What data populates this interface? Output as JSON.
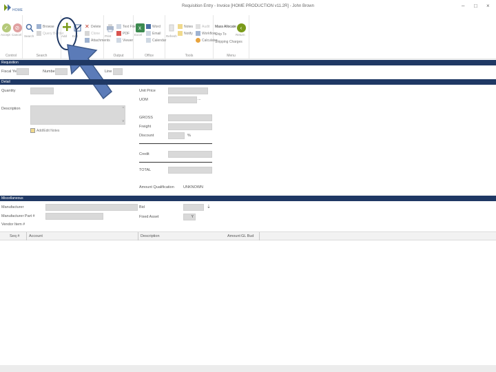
{
  "window": {
    "logo_text": "HOME",
    "title": "Requisition Entry - Invoice [HOME PRODUCTION v11.2R] - John Brown",
    "min_btn": "–",
    "max_btn": "□",
    "close_btn": "×"
  },
  "ribbon": {
    "groups": {
      "control": "Control",
      "search": "Search",
      "output": "Output",
      "office": "Office",
      "tools": "Tools",
      "menu": "Menu"
    },
    "buttons": {
      "accept": "Accept",
      "cancel": "Cancel",
      "search": "Search",
      "browse": "Browse",
      "query_builder": "Query Builder",
      "add": "Add",
      "edit": "Edit",
      "delete": "Delete",
      "clone": "Clone",
      "attachments": "Attachments",
      "print": "Print",
      "text_file": "Text File",
      "pdf": "PDF",
      "viewer": "Viewer",
      "excel": "Excel",
      "word": "Word",
      "email": "Email",
      "calendar": "Calendar",
      "refresh": "Refresh",
      "notes": "Notes",
      "notify": "Notify",
      "audit": "Audit",
      "workflow": "Workflow",
      "calculator": "Calculator",
      "mass_allocate": "Mass Allocate",
      "ship_to": "Ship To",
      "shipping_charges": "Shipping Charges",
      "return": "Return"
    }
  },
  "requisition": {
    "section_title": "Requisition",
    "fiscal_year_label": "Fiscal Year",
    "number_label": "Number",
    "line_label": "Line"
  },
  "detail": {
    "section_title": "Detail",
    "quantity_label": "Quantity",
    "description_label": "Description",
    "add_notes_label": "Add/Edit Notes",
    "unit_price_label": "Unit Price",
    "uom_label": "UOM",
    "uom_btn": "...",
    "gross_label": "GROSS",
    "freight_label": "Freight",
    "discount_label": "Discount",
    "discount_unit": "%",
    "credit_label": "Credit",
    "total_label": "TOTAL",
    "amount_qual_label": "Amount Qualification",
    "amount_qual_value": "UNKNOWN"
  },
  "misc": {
    "section_title": "Miscellaneous",
    "manufacturer_label": "Manufacturer",
    "manufacturer_part_label": "Manufacturer Part #",
    "vendor_item_label": "Vendor Item #",
    "bid_label": "Bid",
    "fixed_asset_label": "Fixed Asset",
    "fixed_asset_value": "Y"
  },
  "grid": {
    "columns": [
      "Seq #",
      "Account",
      "Description",
      "Amount",
      "GL Bud"
    ]
  },
  "colors": {
    "section_bg": "#1f3864",
    "add_icon": "#7a9a1a",
    "arrow_fill": "#5b7bb8"
  }
}
